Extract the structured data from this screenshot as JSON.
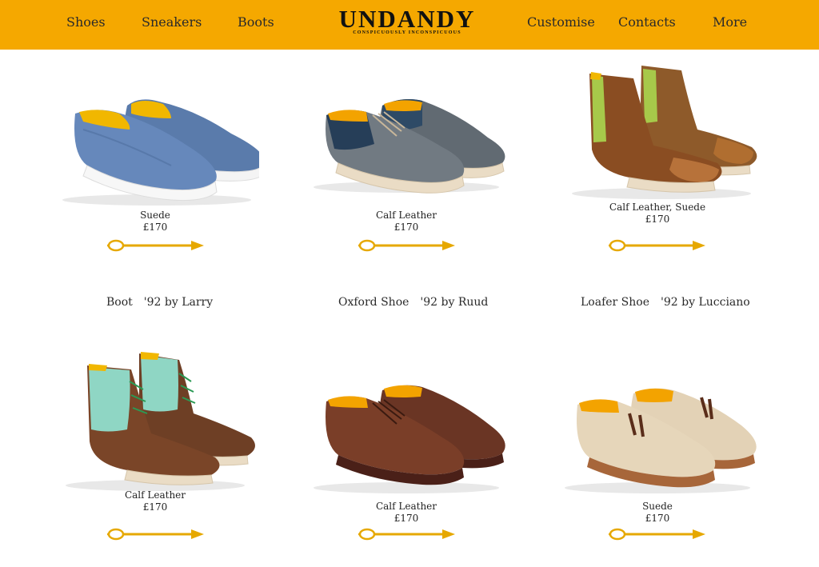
{
  "nav": {
    "left": [
      "Shoes",
      "Sneakers",
      "Boots"
    ],
    "right": [
      "Customise",
      "Contacts",
      "More"
    ]
  },
  "logo": {
    "name": "UNDANDY",
    "tagline": "CONSPICUOUSLY INCONSPICUOUS"
  },
  "colors": {
    "brand": "#f5a800",
    "arrow": "#e6a800"
  },
  "products_top": [
    {
      "material": "Suede",
      "price": "£170"
    },
    {
      "material": "Calf Leather",
      "price": "£170"
    },
    {
      "material": "Calf Leather, Suede",
      "price": "£170"
    }
  ],
  "models": [
    {
      "type": "Boot",
      "name": "'92 by Larry"
    },
    {
      "type": "Oxford Shoe",
      "name": "'92 by Ruud"
    },
    {
      "type": "Loafer Shoe",
      "name": "'92 by Lucciano"
    }
  ],
  "products_bottom": [
    {
      "material": "Calf Leather",
      "price": "£170"
    },
    {
      "material": "Calf Leather",
      "price": "£170"
    },
    {
      "material": "Suede",
      "price": "£170"
    }
  ]
}
